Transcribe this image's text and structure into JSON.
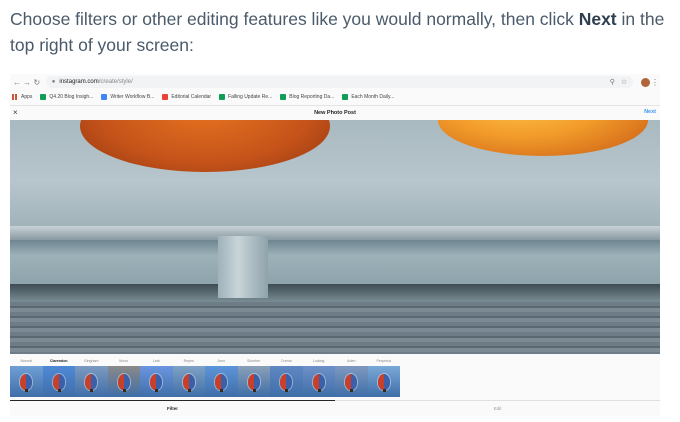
{
  "instruction": {
    "pre": "Choose filters or other editing features like you would normally, then click ",
    "bold": "Next",
    "post": " in the top right of your screen:"
  },
  "browser": {
    "url_host": "instagram.com",
    "url_path": "/create/style/",
    "bookmarks": [
      {
        "label": "Apps",
        "color": "#c53929"
      },
      {
        "label": "Q4.20 Blog Insigh...",
        "color": "#0f9d58"
      },
      {
        "label": "Writer Workflow B...",
        "color": "#4285f4"
      },
      {
        "label": "Editorial Calendar",
        "color": "#ea4335"
      },
      {
        "label": "Falling Update Re...",
        "color": "#0f9d58"
      },
      {
        "label": "Blog Reporting Da...",
        "color": "#0f9d58"
      },
      {
        "label": "Each Month Daily...",
        "color": "#0f9d58"
      }
    ]
  },
  "instagram": {
    "close_icon": "×",
    "title": "New Photo Post",
    "next_label": "Next",
    "filters": [
      {
        "name": "Normal",
        "active": false
      },
      {
        "name": "Clarendon",
        "active": true
      },
      {
        "name": "Gingham",
        "active": false
      },
      {
        "name": "Moon",
        "active": false
      },
      {
        "name": "Lark",
        "active": false
      },
      {
        "name": "Reyes",
        "active": false
      },
      {
        "name": "Juno",
        "active": false
      },
      {
        "name": "Slumber",
        "active": false
      },
      {
        "name": "Crema",
        "active": false
      },
      {
        "name": "Ludwig",
        "active": false
      },
      {
        "name": "Aden",
        "active": false
      },
      {
        "name": "Perpetua",
        "active": false
      }
    ],
    "tabs": [
      {
        "label": "Filter",
        "active": true
      },
      {
        "label": "Edit",
        "active": false
      }
    ]
  },
  "colors": {
    "accent_link": "#3897f0",
    "text": "#4a5a6a"
  }
}
